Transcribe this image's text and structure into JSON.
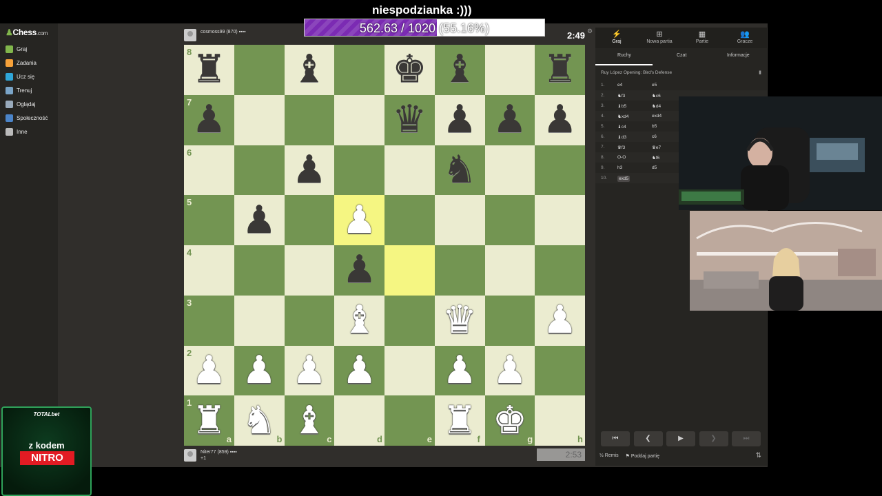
{
  "overlay": {
    "title": "niespodzianka :)))",
    "progress_text": "562.63 / 1020 (55.16%)",
    "progress_fraction": 0.5516,
    "fill_color": "#7b2bb3"
  },
  "nav": {
    "logo": "Chess",
    "logo_suffix": ".com",
    "items": [
      {
        "label": "Graj",
        "icon": "play-icon",
        "color": "#81b64c"
      },
      {
        "label": "Zadania",
        "icon": "puzzle-icon",
        "color": "#f7a23a"
      },
      {
        "label": "Ucz się",
        "icon": "learn-icon",
        "color": "#2fa6d8"
      },
      {
        "label": "Trenuj",
        "icon": "train-icon",
        "color": "#7aa4c7"
      },
      {
        "label": "Oglądaj",
        "icon": "watch-icon",
        "color": "#9ab"
      },
      {
        "label": "Społeczność",
        "icon": "community-icon",
        "color": "#4b84c8"
      },
      {
        "label": "Inne",
        "icon": "more-icon",
        "color": "#bbb"
      }
    ]
  },
  "top_player": {
    "name": "cosmoss99 (870) ▪▪▪▪",
    "clock": "2:49"
  },
  "bottom_player": {
    "name": "Niter77 (859) ▪▪▪▪",
    "sub": "+1",
    "clock": "2:53"
  },
  "board": {
    "ranks": [
      "8",
      "7",
      "6",
      "5",
      "4",
      "3",
      "2",
      "1"
    ],
    "files": [
      "a",
      "b",
      "c",
      "d",
      "e",
      "f",
      "g",
      "h"
    ],
    "highlights": [
      "d5",
      "e4"
    ],
    "pieces": [
      {
        "sq": "a8",
        "p": "♜",
        "c": "b"
      },
      {
        "sq": "c8",
        "p": "♝",
        "c": "b"
      },
      {
        "sq": "e8",
        "p": "♚",
        "c": "b"
      },
      {
        "sq": "f8",
        "p": "♝",
        "c": "b"
      },
      {
        "sq": "h8",
        "p": "♜",
        "c": "b"
      },
      {
        "sq": "a7",
        "p": "♟",
        "c": "b"
      },
      {
        "sq": "e7",
        "p": "♛",
        "c": "b"
      },
      {
        "sq": "f7",
        "p": "♟",
        "c": "b"
      },
      {
        "sq": "g7",
        "p": "♟",
        "c": "b"
      },
      {
        "sq": "h7",
        "p": "♟",
        "c": "b"
      },
      {
        "sq": "c6",
        "p": "♟",
        "c": "b"
      },
      {
        "sq": "f6",
        "p": "♞",
        "c": "b"
      },
      {
        "sq": "b5",
        "p": "♟",
        "c": "b"
      },
      {
        "sq": "d5",
        "p": "♟",
        "c": "w"
      },
      {
        "sq": "d4",
        "p": "♟",
        "c": "b"
      },
      {
        "sq": "d3",
        "p": "♝",
        "c": "w"
      },
      {
        "sq": "f3",
        "p": "♛",
        "c": "w"
      },
      {
        "sq": "h3",
        "p": "♟",
        "c": "w"
      },
      {
        "sq": "a2",
        "p": "♟",
        "c": "w"
      },
      {
        "sq": "b2",
        "p": "♟",
        "c": "w"
      },
      {
        "sq": "c2",
        "p": "♟",
        "c": "w"
      },
      {
        "sq": "d2",
        "p": "♟",
        "c": "w"
      },
      {
        "sq": "f2",
        "p": "♟",
        "c": "w"
      },
      {
        "sq": "g2",
        "p": "♟",
        "c": "w"
      },
      {
        "sq": "a1",
        "p": "♜",
        "c": "w"
      },
      {
        "sq": "b1",
        "p": "♞",
        "c": "w"
      },
      {
        "sq": "c1",
        "p": "♝",
        "c": "w"
      },
      {
        "sq": "f1",
        "p": "♜",
        "c": "w"
      },
      {
        "sq": "g1",
        "p": "♚",
        "c": "w"
      }
    ]
  },
  "panel": {
    "tabs": [
      {
        "label": "Graj",
        "icon": "play-icon",
        "glyph": "⚡"
      },
      {
        "label": "Nowa partia",
        "icon": "plus-icon",
        "glyph": "⊞"
      },
      {
        "label": "Partie",
        "icon": "board-icon",
        "glyph": "▦"
      },
      {
        "label": "Gracze",
        "icon": "players-icon",
        "glyph": "👥"
      }
    ],
    "subtabs": [
      "Ruchy",
      "Czat",
      "Informacje"
    ],
    "opening": "Ruy López Opening: Bird's Defense",
    "moves": [
      {
        "n": "1.",
        "w": "e4",
        "b": "e5"
      },
      {
        "n": "2.",
        "w": "♞f3",
        "b": "♞c6"
      },
      {
        "n": "3.",
        "w": "♝b5",
        "b": "♞d4"
      },
      {
        "n": "4.",
        "w": "♞xd4",
        "b": "exd4"
      },
      {
        "n": "5.",
        "w": "♝c4",
        "b": "b5"
      },
      {
        "n": "6.",
        "w": "♝d3",
        "b": "c6"
      },
      {
        "n": "7.",
        "w": "♛f3",
        "b": "♛e7"
      },
      {
        "n": "8.",
        "w": "O-O",
        "b": "♞f6"
      },
      {
        "n": "9.",
        "w": "h3",
        "b": "d5"
      },
      {
        "n": "10.",
        "w": "exd5",
        "b": ""
      }
    ],
    "controls": [
      "⏮",
      "❮",
      "▶",
      "❯",
      "⏭"
    ],
    "draw": "½ Remis",
    "resign": "⚑ Poddaj partię"
  },
  "sponsor": {
    "brand": "TOTALbet",
    "line1": "z kodem",
    "code": "NITRO"
  }
}
